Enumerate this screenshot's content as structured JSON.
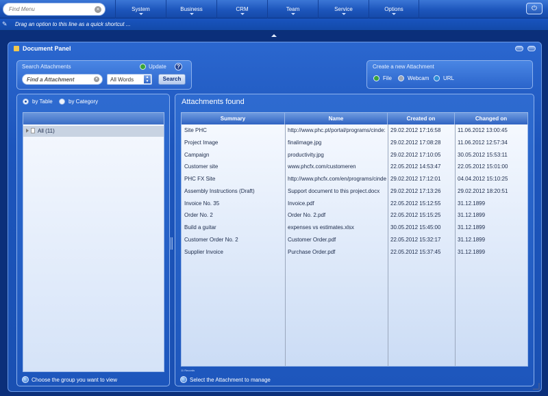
{
  "topbar": {
    "find_menu_placeholder": "Find Menu",
    "menu": [
      "System",
      "Business",
      "CRM",
      "Team",
      "Service",
      "Options"
    ]
  },
  "shortcut_bar": {
    "text": "Drag an option to this line as a quick shortcut ..."
  },
  "panel": {
    "title": "Document Panel",
    "search": {
      "label": "Search Attachments",
      "update_label": "Update",
      "help": "?",
      "input_placeholder": "Find a Attachment",
      "words_value": "All Words",
      "button_label": "Search"
    },
    "create": {
      "label": "Create a new Attachment",
      "options": [
        "File",
        "Webcam",
        "URL"
      ]
    },
    "left": {
      "view_by_table": "by Table",
      "view_by_category": "by Category",
      "tree_root": "All (11)",
      "footer": "Choose the group you want to view"
    },
    "right": {
      "title": "Attachments found",
      "columns": [
        "Summary",
        "Name",
        "Created on",
        "Changed on"
      ],
      "rows": [
        [
          "Site PHC",
          "http://www.phc.pt/portal/programs/cinde:",
          "29.02.2012  17:16:58",
          "11.06.2012  13:00:45"
        ],
        [
          "Project Image",
          "finalimage.jpg",
          "29.02.2012  17:08:28",
          "11.06.2012  12:57:34"
        ],
        [
          "Campaign",
          "productivity.jpg",
          "29.02.2012  17:10:05",
          "30.05.2012  15:53:11"
        ],
        [
          "Customer site",
          "www.phcfx.com/customeren",
          "22.05.2012  14:53:47",
          "22.05.2012  15:01:00"
        ],
        [
          "PHC FX Site",
          "http://www.phcfx.com/en/programs/cinde",
          "29.02.2012  17:12:01",
          "04.04.2012  15:10:25"
        ],
        [
          "Assembly Instructions (Draft)",
          "Support document to this project.docx",
          "29.02.2012  17:13:26",
          "29.02.2012  18:20:51"
        ],
        [
          "Invoice No. 35",
          "Invoice.pdf",
          "22.05.2012  15:12:55",
          "31.12.1899"
        ],
        [
          "Order No. 2",
          "Order No. 2.pdf",
          "22.05.2012  15:15:25",
          "31.12.1899"
        ],
        [
          "Build a guitar",
          "expenses vs estimates.xlsx",
          "30.05.2012  15:45:00",
          "31.12.1899"
        ],
        [
          "Customer Order No. 2",
          "Customer Order.pdf",
          "22.05.2012  15:32:17",
          "31.12.1899"
        ],
        [
          "Supplier Invoice",
          "Purchase Order.pdf",
          "22.05.2012  15:37:45",
          "31.12.1899"
        ]
      ],
      "grid_status": "11 Records",
      "footer": "Select the Attachment to manage"
    }
  },
  "colors": {
    "background": "#0b2f7a",
    "panel": "#1c55bc",
    "accent": "#3b76d6"
  }
}
